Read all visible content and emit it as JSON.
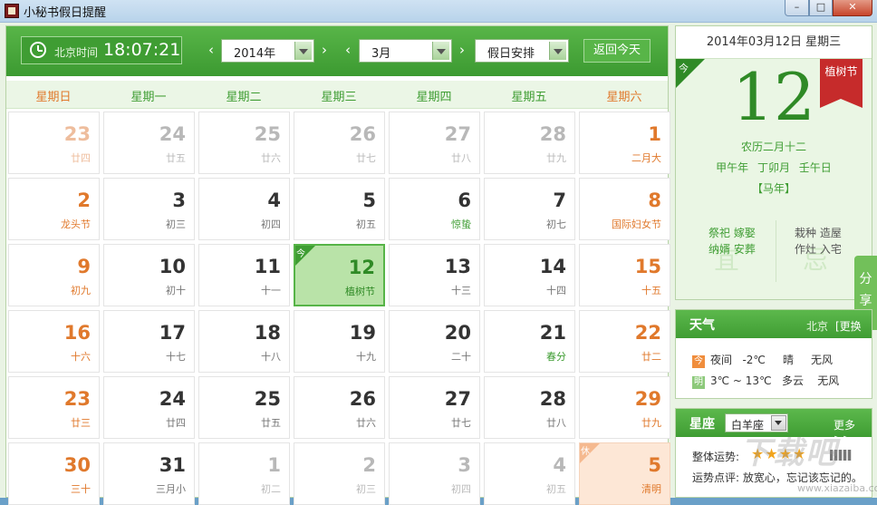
{
  "window": {
    "title": "小秘书假日提醒",
    "minimize": "–",
    "maximize": "□",
    "close": "✕"
  },
  "toolbar": {
    "clock_label": "北京时间",
    "time": "18:07:21",
    "year": "2014年",
    "month": "3月",
    "mode": "假日安排",
    "today_button": "返回今天",
    "prev": "‹",
    "next": "›"
  },
  "weekdays": [
    "星期日",
    "星期一",
    "星期二",
    "星期三",
    "星期四",
    "星期五",
    "星期六"
  ],
  "calendar": {
    "rows": [
      [
        {
          "day": "23",
          "sub": "廿四",
          "state": "other"
        },
        {
          "day": "24",
          "sub": "廿五",
          "state": "other"
        },
        {
          "day": "25",
          "sub": "廿六",
          "state": "other"
        },
        {
          "day": "26",
          "sub": "廿七",
          "state": "other"
        },
        {
          "day": "27",
          "sub": "廿八",
          "state": "other"
        },
        {
          "day": "28",
          "sub": "廿九",
          "state": "other"
        },
        {
          "day": "1",
          "sub": "二月大",
          "state": "normal"
        }
      ],
      [
        {
          "day": "2",
          "sub": "龙头节",
          "state": "normal",
          "fest": true
        },
        {
          "day": "3",
          "sub": "初三",
          "state": "normal"
        },
        {
          "day": "4",
          "sub": "初四",
          "state": "normal"
        },
        {
          "day": "5",
          "sub": "初五",
          "state": "normal"
        },
        {
          "day": "6",
          "sub": "惊蛰",
          "state": "normal",
          "fest": true
        },
        {
          "day": "7",
          "sub": "初七",
          "state": "normal"
        },
        {
          "day": "8",
          "sub": "国际妇女节",
          "state": "normal",
          "fest": true
        }
      ],
      [
        {
          "day": "9",
          "sub": "初九",
          "state": "normal"
        },
        {
          "day": "10",
          "sub": "初十",
          "state": "normal"
        },
        {
          "day": "11",
          "sub": "十一",
          "state": "normal"
        },
        {
          "day": "12",
          "sub": "植树节",
          "state": "selected",
          "corner": "今"
        },
        {
          "day": "13",
          "sub": "十三",
          "state": "normal"
        },
        {
          "day": "14",
          "sub": "十四",
          "state": "normal"
        },
        {
          "day": "15",
          "sub": "十五",
          "state": "normal",
          "fest": true
        }
      ],
      [
        {
          "day": "16",
          "sub": "十六",
          "state": "normal"
        },
        {
          "day": "17",
          "sub": "十七",
          "state": "normal"
        },
        {
          "day": "18",
          "sub": "十八",
          "state": "normal"
        },
        {
          "day": "19",
          "sub": "十九",
          "state": "normal"
        },
        {
          "day": "20",
          "sub": "二十",
          "state": "normal"
        },
        {
          "day": "21",
          "sub": "春分",
          "state": "normal",
          "fest": true
        },
        {
          "day": "22",
          "sub": "廿二",
          "state": "normal"
        }
      ],
      [
        {
          "day": "23",
          "sub": "廿三",
          "state": "normal"
        },
        {
          "day": "24",
          "sub": "廿四",
          "state": "normal"
        },
        {
          "day": "25",
          "sub": "廿五",
          "state": "normal"
        },
        {
          "day": "26",
          "sub": "廿六",
          "state": "normal"
        },
        {
          "day": "27",
          "sub": "廿七",
          "state": "normal"
        },
        {
          "day": "28",
          "sub": "廿八",
          "state": "normal"
        },
        {
          "day": "29",
          "sub": "廿九",
          "state": "normal"
        }
      ],
      [
        {
          "day": "30",
          "sub": "三十",
          "state": "normal"
        },
        {
          "day": "31",
          "sub": "三月小",
          "state": "normal"
        },
        {
          "day": "1",
          "sub": "初二",
          "state": "other"
        },
        {
          "day": "2",
          "sub": "初三",
          "state": "other"
        },
        {
          "day": "3",
          "sub": "初四",
          "state": "other"
        },
        {
          "day": "4",
          "sub": "初五",
          "state": "other"
        },
        {
          "day": "5",
          "sub": "清明",
          "state": "rest",
          "corner": "休"
        }
      ]
    ]
  },
  "detail": {
    "date_line": "2014年03月12日 星期三",
    "today_tag": "今",
    "day": "12",
    "festival": "植树节",
    "lunar": "农历二月十二",
    "ganzhi": "甲午年 丁卯月 壬午日",
    "zodiac": "【马年】",
    "yi_watermark": "宜",
    "ji_watermark": "忌",
    "yi_1": "祭祀 嫁娶",
    "yi_2": "纳婿 安葬",
    "ji_1": "栽种 造屋",
    "ji_2": "作灶 入宅"
  },
  "share": {
    "label": "分享"
  },
  "weather": {
    "header": "天气",
    "city": "北京",
    "change": "[更换",
    "rows": [
      {
        "tag": "今",
        "text": "夜间   -2℃     晴     无风"
      },
      {
        "tag": "明",
        "text": "3℃ ~ 13℃   多云    无风"
      }
    ]
  },
  "horoscope": {
    "header": "星座",
    "sign": "白羊座",
    "more": "更多>>",
    "overall_label": "整体运势:",
    "stars": "★★★★",
    "comment": "运势点评: 放宽心，忘记该忘记的。"
  },
  "watermark": {
    "text": "下载吧",
    "url": "www.xiazaiba.com"
  }
}
